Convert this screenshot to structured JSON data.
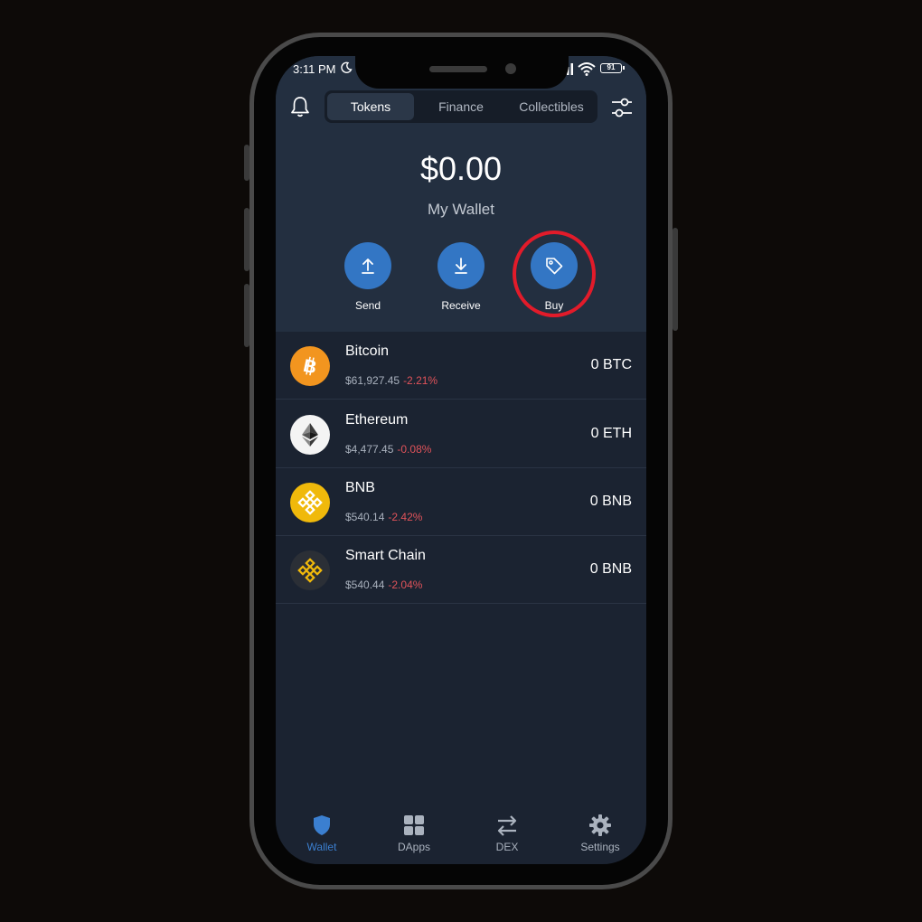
{
  "status_bar": {
    "time": "3:11 PM",
    "battery": "91"
  },
  "tabs": [
    {
      "label": "Tokens",
      "active": true
    },
    {
      "label": "Finance",
      "active": false
    },
    {
      "label": "Collectibles",
      "active": false
    }
  ],
  "wallet": {
    "balance": "$0.00",
    "name": "My Wallet"
  },
  "actions": [
    {
      "label": "Send",
      "icon": "send-icon"
    },
    {
      "label": "Receive",
      "icon": "receive-icon"
    },
    {
      "label": "Buy",
      "icon": "tag-icon",
      "highlighted": true
    }
  ],
  "tokens": [
    {
      "name": "Bitcoin",
      "price": "$61,927.45",
      "change": "-2.21%",
      "amount": "0 BTC",
      "icon": "bitcoin-icon"
    },
    {
      "name": "Ethereum",
      "price": "$4,477.45",
      "change": "-0.08%",
      "amount": "0 ETH",
      "icon": "ethereum-icon"
    },
    {
      "name": "BNB",
      "price": "$540.14",
      "change": "-2.42%",
      "amount": "0 BNB",
      "icon": "bnb-icon"
    },
    {
      "name": "Smart Chain",
      "price": "$540.44",
      "change": "-2.04%",
      "amount": "0 BNB",
      "icon": "smart-chain-icon"
    }
  ],
  "nav": [
    {
      "label": "Wallet",
      "icon": "shield-icon",
      "active": true
    },
    {
      "label": "DApps",
      "icon": "grid-icon",
      "active": false
    },
    {
      "label": "DEX",
      "icon": "swap-icon",
      "active": false
    },
    {
      "label": "Settings",
      "icon": "gear-icon",
      "active": false
    }
  ],
  "colors": {
    "accent": "#3376c4",
    "highlight_ring": "#e21b2a",
    "negative": "#e0535a",
    "background": "#1b2331"
  }
}
